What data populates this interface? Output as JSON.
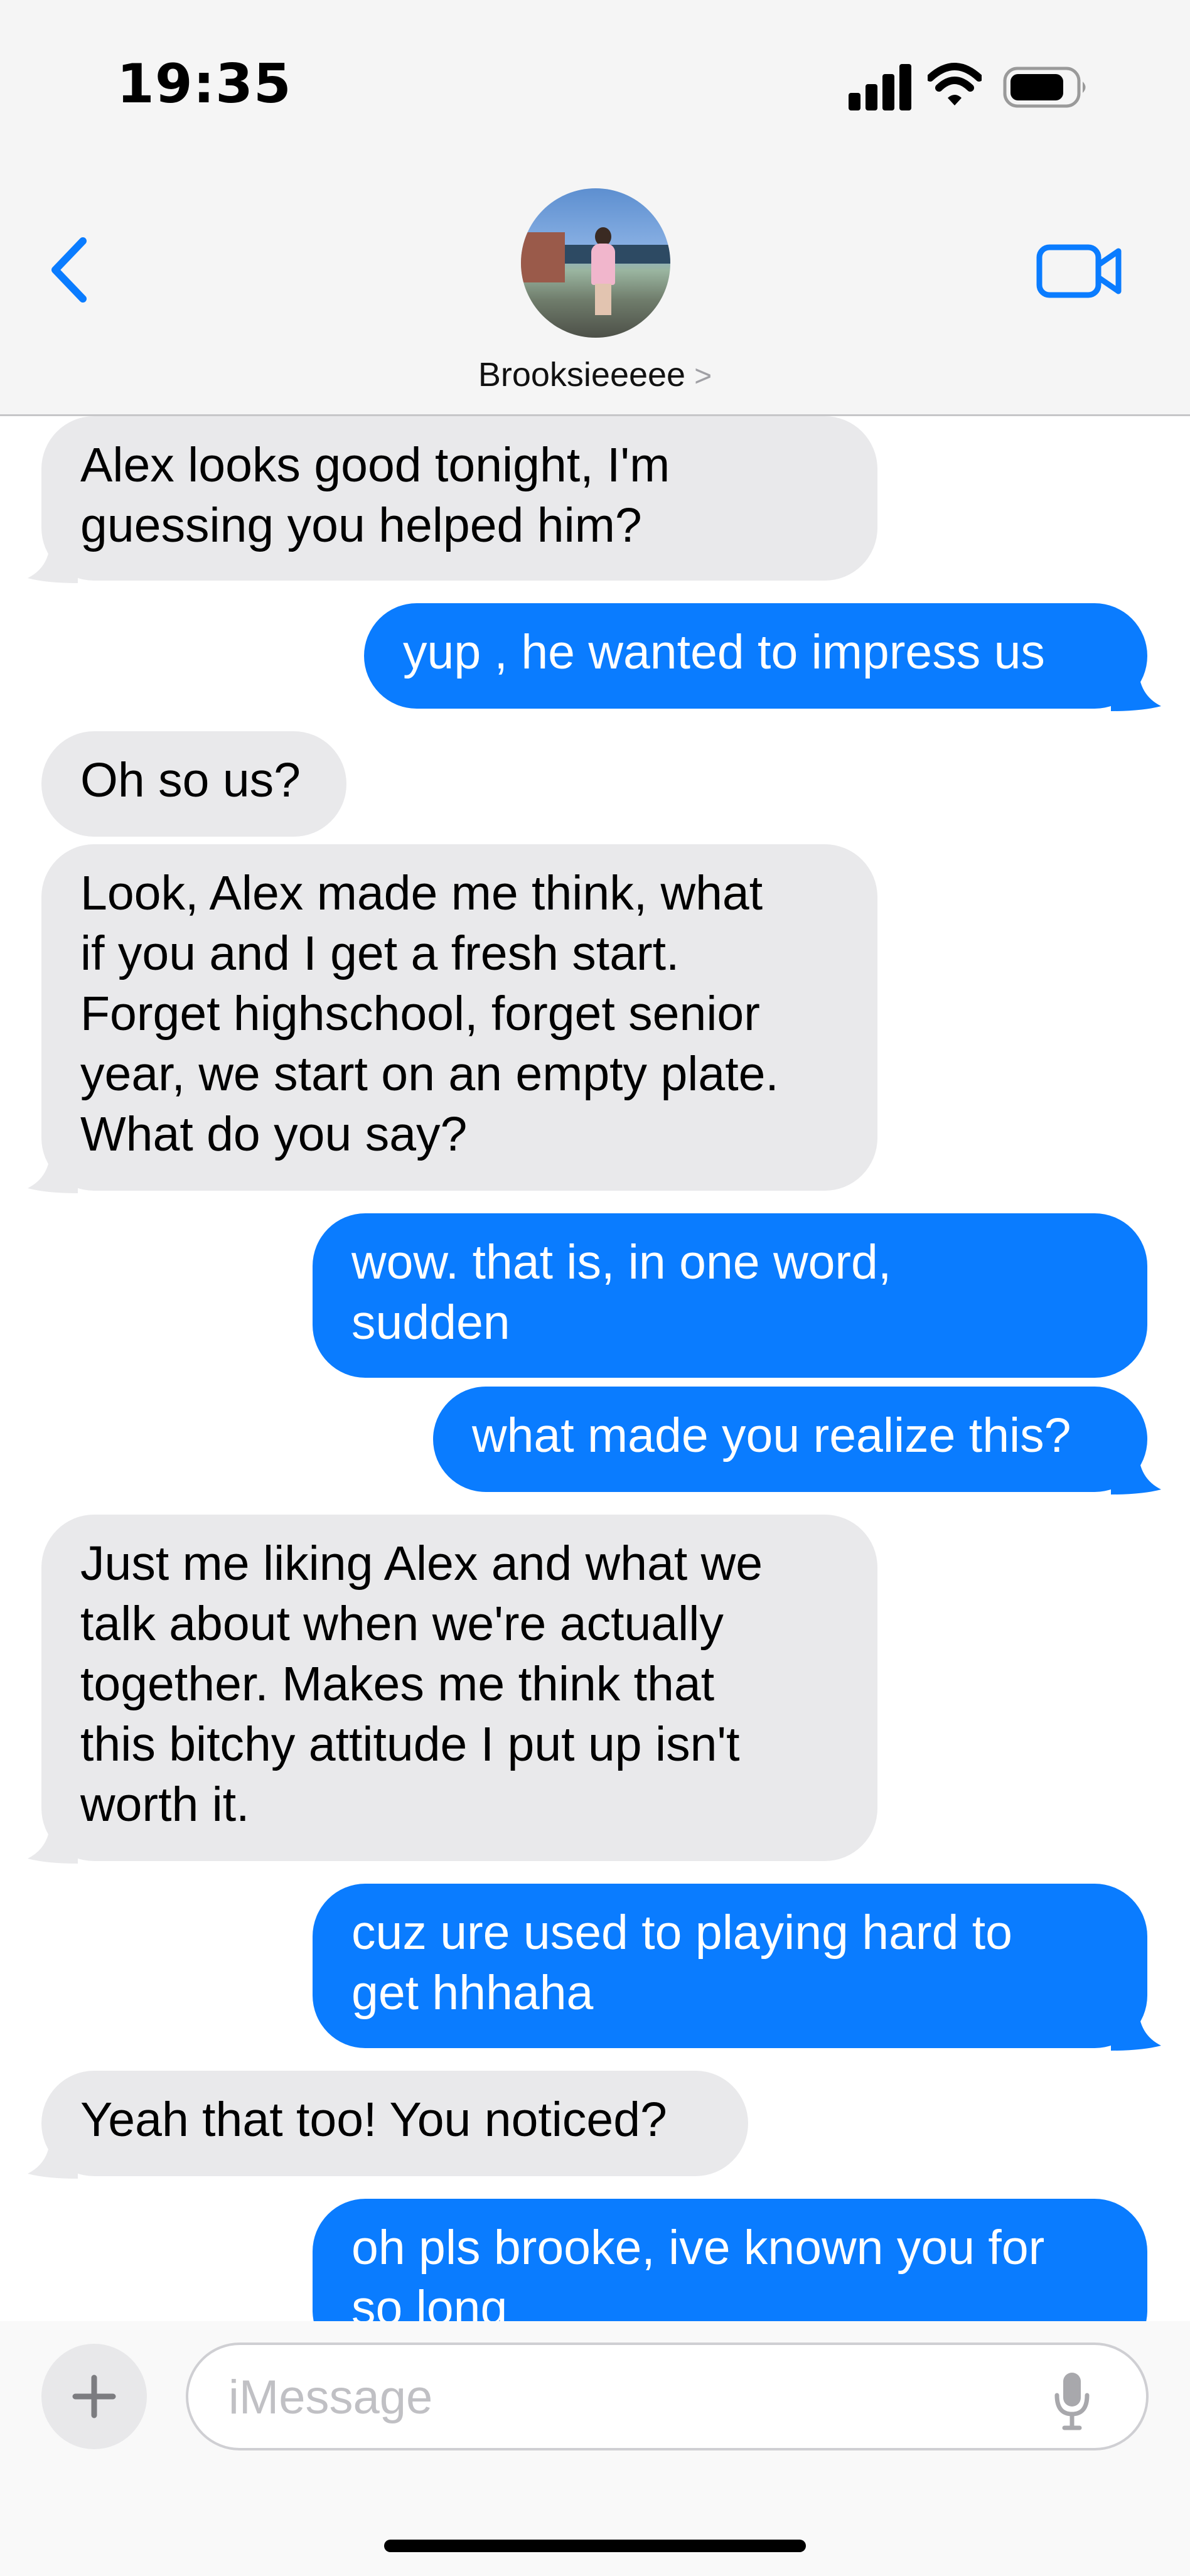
{
  "status_bar": {
    "time": "19:35",
    "signal_icon": "cellular-signal-icon",
    "wifi_icon": "wifi-icon",
    "battery_icon": "battery-icon"
  },
  "header": {
    "back_icon": "chevron-left-icon",
    "contact_name": "Brooksieeeee",
    "contact_chevron": ">",
    "video_icon": "video-camera-icon"
  },
  "messages": [
    {
      "from": "them",
      "lines": [
        "Alex looks good tonight, I'm",
        "guessing you helped him?"
      ]
    },
    {
      "from": "me",
      "lines": [
        "yup , he wanted to impress us"
      ]
    },
    {
      "from": "them",
      "lines": [
        "Oh so us?"
      ]
    },
    {
      "from": "them",
      "lines": [
        "Look, Alex made me think, what",
        "if you and I get a fresh start.",
        "Forget highschool, forget senior",
        "year, we start on an empty plate.",
        "What do you say?"
      ]
    },
    {
      "from": "me",
      "lines": [
        "wow. that is, in one word,",
        "sudden"
      ]
    },
    {
      "from": "me",
      "lines": [
        "what made you realize this?"
      ]
    },
    {
      "from": "them",
      "lines": [
        "Just me liking Alex and what we",
        "talk about when we're actually",
        "together. Makes me think that",
        "this bitchy attitude I put up isn't",
        "worth it."
      ]
    },
    {
      "from": "me",
      "lines": [
        "cuz ure used to playing hard to",
        "get hhhaha"
      ]
    },
    {
      "from": "them",
      "lines": [
        "Yeah that too! You noticed?"
      ]
    },
    {
      "from": "me",
      "lines": [
        "oh pls brooke, ive known you for",
        "so long"
      ]
    }
  ],
  "input_bar": {
    "plus_icon": "plus-icon",
    "placeholder": "iMessage",
    "mic_icon": "microphone-icon"
  },
  "colors": {
    "outgoing_bubble": "#0a7cff",
    "incoming_bubble": "#e9e9eb",
    "accent": "#0a7cff",
    "header_background": "#f5f5f5"
  }
}
